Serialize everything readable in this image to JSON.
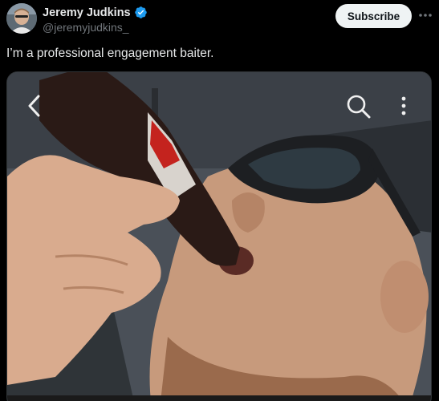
{
  "author": {
    "name": "Jeremy Judkins",
    "handle": "@jeremyjudkins_",
    "verified": true,
    "badge_color": "#1d9bf0"
  },
  "header": {
    "subscribe_label": "Subscribe",
    "more_icon": "more-horizontal-icon"
  },
  "post": {
    "text": "I’m a professional engagement baiter."
  },
  "media": {
    "type": "video",
    "overlay_icons": [
      "back-chevron-icon",
      "search-icon",
      "more-vertical-icon"
    ]
  },
  "colors": {
    "background": "#000000",
    "text_primary": "#e7e9ea",
    "text_secondary": "#71767b",
    "button_bg": "#eff3f4"
  }
}
